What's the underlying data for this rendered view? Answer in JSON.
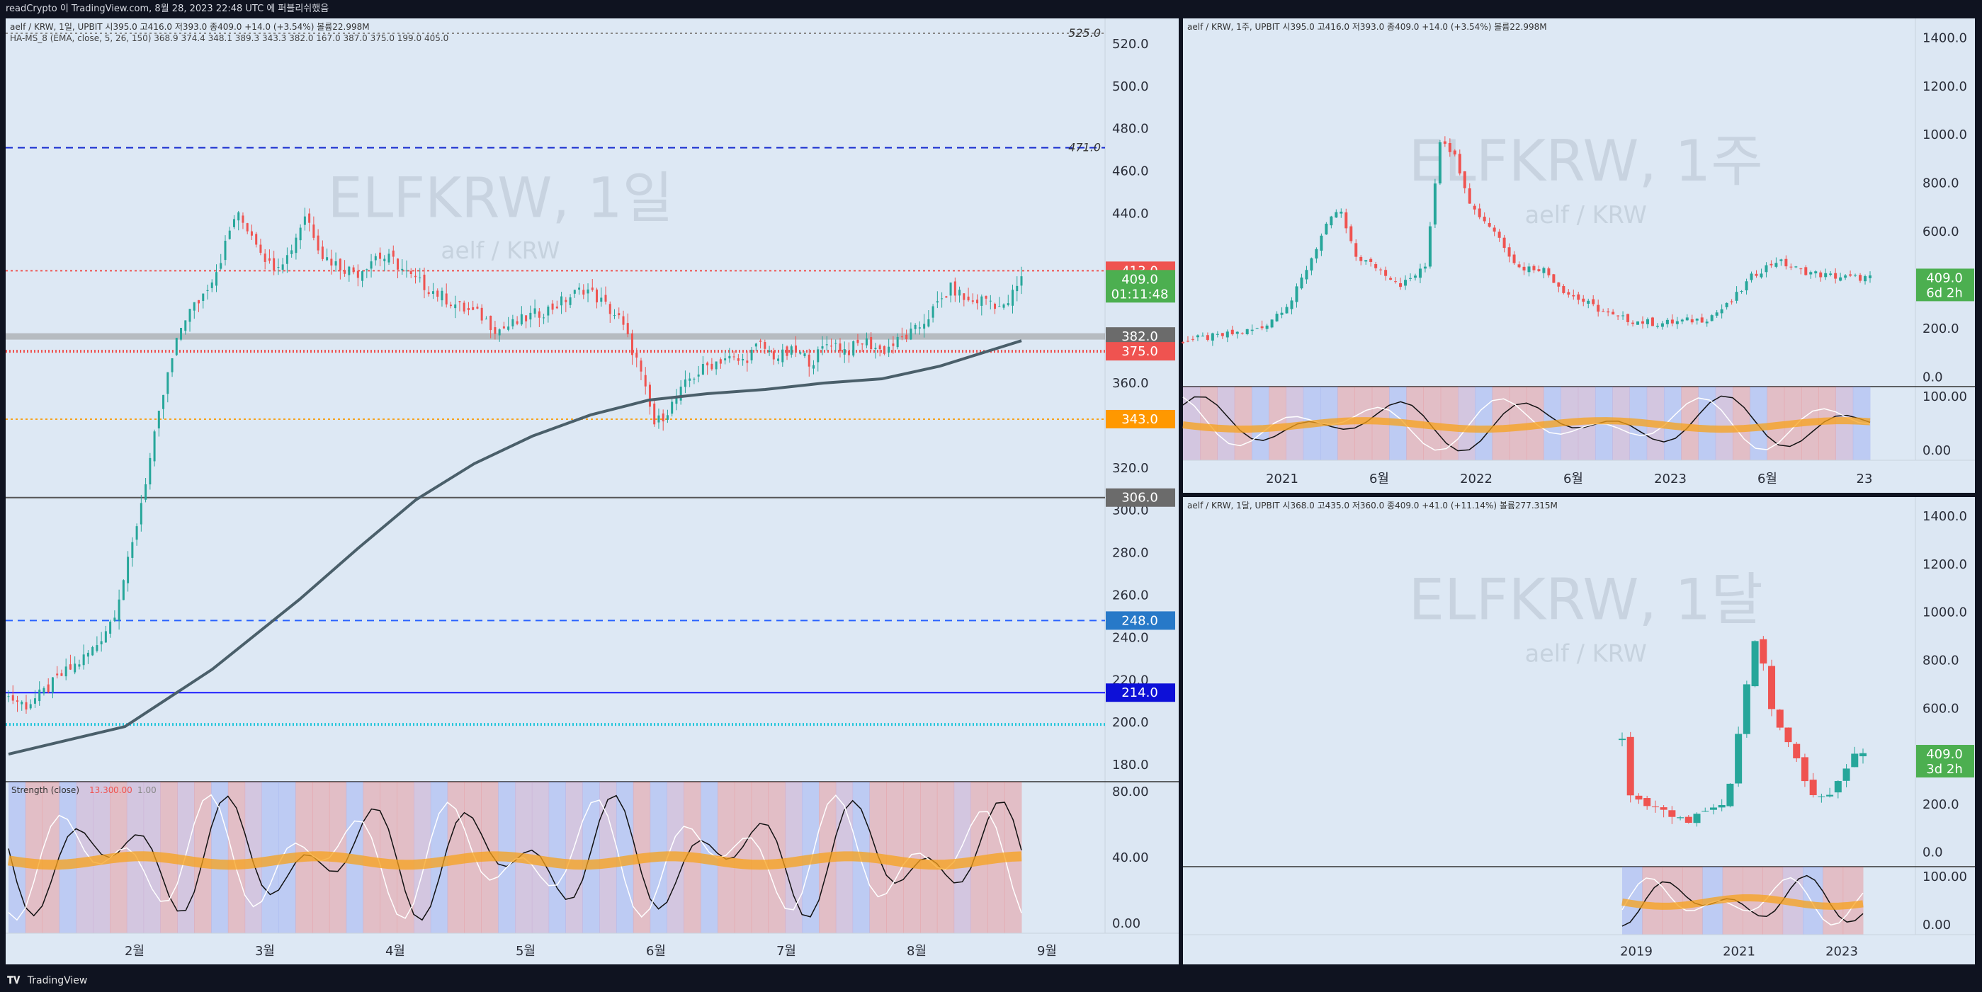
{
  "header": {
    "publish_text": "readCrypto 이 TradingView.com, 8월 28, 2023 22:48 UTC 에 퍼블리쉬했음"
  },
  "footer": {
    "brand": "TradingView",
    "logo": "tv-logo-icon"
  },
  "colors": {
    "bg": "#dfe9f5",
    "up": "#26a69a",
    "down": "#ef5350",
    "sma": "#4a5f6a",
    "green_tag": "#4caf50"
  },
  "chart_data": [
    {
      "type": "candlestick",
      "panel": "daily",
      "legend_line": "aelf / KRW, 1일, UPBIT  시395.0  고416.0  저393.0  종409.0  +14.0 (+3.54%)  볼륨22.998M",
      "indicator_line": "HA-MS_8 (EMA, close, 5, 26, 150)  368.9  374.4  348.1  389.3  343.3  382.0  167.0  387.0  375.0  199.0  405.0",
      "watermark": "ELFKRW, 1일",
      "watermark_sub": "aelf / KRW",
      "yticks": [
        "520.0",
        "500.0",
        "480.0",
        "460.0",
        "440.0",
        "420.0",
        "400.0",
        "380.0",
        "360.0",
        "340.0",
        "320.0",
        "300.0",
        "280.0",
        "260.0",
        "240.0",
        "220.0",
        "200.0",
        "180.0"
      ],
      "yticks_display": [
        "520.0",
        "500.0",
        "480.0",
        "460.0",
        "440.0",
        "",
        "",
        "",
        "360.0",
        "",
        "320.0",
        "300.0",
        "280.0",
        "260.0",
        "240.0",
        "220.0",
        "200.0",
        "180.0"
      ],
      "ylim": [
        172,
        532
      ],
      "xticks": [
        "2월",
        "3월",
        "4월",
        "5월",
        "6월",
        "7월",
        "8월",
        "9월"
      ],
      "close_path": [
        [
          0,
          212
        ],
        [
          3,
          208
        ],
        [
          6,
          214
        ],
        [
          9,
          222
        ],
        [
          12,
          228
        ],
        [
          15,
          236
        ],
        [
          18,
          250
        ],
        [
          21,
          280
        ],
        [
          24,
          320
        ],
        [
          27,
          360
        ],
        [
          30,
          390
        ],
        [
          33,
          400
        ],
        [
          36,
          415
        ],
        [
          39,
          440
        ],
        [
          42,
          430
        ],
        [
          45,
          415
        ],
        [
          48,
          420
        ],
        [
          51,
          440
        ],
        [
          54,
          420
        ],
        [
          57,
          415
        ],
        [
          60,
          412
        ],
        [
          63,
          420
        ],
        [
          66,
          418
        ],
        [
          69,
          410
        ],
        [
          72,
          405
        ],
        [
          75,
          400
        ],
        [
          78,
          395
        ],
        [
          81,
          392
        ],
        [
          84,
          385
        ],
        [
          87,
          388
        ],
        [
          90,
          392
        ],
        [
          93,
          395
        ],
        [
          96,
          400
        ],
        [
          99,
          405
        ],
        [
          102,
          398
        ],
        [
          105,
          390
        ],
        [
          108,
          370
        ],
        [
          111,
          340
        ],
        [
          114,
          350
        ],
        [
          117,
          362
        ],
        [
          120,
          368
        ],
        [
          123,
          372
        ],
        [
          126,
          370
        ],
        [
          129,
          378
        ],
        [
          132,
          372
        ],
        [
          135,
          375
        ],
        [
          138,
          370
        ],
        [
          141,
          380
        ],
        [
          144,
          375
        ],
        [
          147,
          380
        ],
        [
          150,
          375
        ],
        [
          153,
          380
        ],
        [
          156,
          385
        ],
        [
          159,
          395
        ],
        [
          162,
          405
        ],
        [
          165,
          398
        ],
        [
          168,
          400
        ],
        [
          171,
          395
        ],
        [
          174,
          409
        ]
      ],
      "high_path": [
        [
          0,
          218
        ],
        [
          12,
          235
        ],
        [
          24,
          330
        ],
        [
          36,
          420
        ],
        [
          39,
          470
        ],
        [
          42,
          455
        ],
        [
          48,
          430
        ],
        [
          51,
          475
        ],
        [
          54,
          450
        ],
        [
          60,
          430
        ],
        [
          72,
          420
        ],
        [
          84,
          400
        ],
        [
          96,
          410
        ],
        [
          102,
          420
        ],
        [
          108,
          390
        ],
        [
          114,
          370
        ],
        [
          120,
          385
        ],
        [
          132,
          385
        ],
        [
          144,
          390
        ],
        [
          156,
          395
        ],
        [
          162,
          435
        ],
        [
          168,
          425
        ],
        [
          174,
          416
        ]
      ],
      "low_path": [
        [
          0,
          205
        ],
        [
          12,
          222
        ],
        [
          24,
          300
        ],
        [
          36,
          380
        ],
        [
          39,
          400
        ],
        [
          48,
          390
        ],
        [
          60,
          392
        ],
        [
          72,
          385
        ],
        [
          84,
          372
        ],
        [
          96,
          375
        ],
        [
          102,
          372
        ],
        [
          108,
          330
        ],
        [
          111,
          328
        ],
        [
          114,
          335
        ],
        [
          120,
          355
        ],
        [
          132,
          358
        ],
        [
          144,
          360
        ],
        [
          156,
          370
        ],
        [
          162,
          380
        ],
        [
          168,
          380
        ],
        [
          174,
          393
        ]
      ],
      "sma150": [
        [
          0,
          185
        ],
        [
          20,
          198
        ],
        [
          35,
          225
        ],
        [
          50,
          258
        ],
        [
          60,
          282
        ],
        [
          70,
          305
        ],
        [
          80,
          322
        ],
        [
          90,
          335
        ],
        [
          100,
          345
        ],
        [
          110,
          352
        ],
        [
          120,
          355
        ],
        [
          130,
          357
        ],
        [
          140,
          360
        ],
        [
          150,
          362
        ],
        [
          160,
          368
        ],
        [
          174,
          380
        ]
      ],
      "level_lines": [
        {
          "value": 471.0,
          "label": "471.0",
          "color": "#1a2fd0",
          "style": "dashed"
        },
        {
          "value": 525.0,
          "label": "525.0",
          "color": "#888",
          "style": "dotted"
        },
        {
          "value": 413.0,
          "label": "",
          "color": "#ef5350",
          "style": "dotted"
        },
        {
          "value": 382.0,
          "label": "",
          "color": "#9e9e9e",
          "style": "thick"
        },
        {
          "value": 375.0,
          "label": "",
          "color": "#ef5350",
          "style": "cross"
        },
        {
          "value": 343.0,
          "label": "",
          "color": "#f7a21b",
          "style": "dotted"
        },
        {
          "value": 306.0,
          "label": "",
          "color": "#555",
          "style": "solid"
        },
        {
          "value": 248.0,
          "label": "",
          "color": "#2962ff",
          "style": "dashed"
        },
        {
          "value": 214.0,
          "label": "",
          "color": "#1a1aff",
          "style": "solid"
        },
        {
          "value": 199.0,
          "label": "",
          "color": "#26c6da",
          "style": "cross"
        }
      ],
      "price_tags": [
        {
          "value": 413.0,
          "text": "413.0",
          "color": "#ef5350"
        },
        {
          "value": 409.0,
          "text": "409.0",
          "sub": "01:11:48",
          "color": "#4caf50"
        },
        {
          "value": 382.0,
          "text": "382.0",
          "color": "#6b6b6b"
        },
        {
          "value": 375.0,
          "text": "375.0",
          "color": "#ef5350"
        },
        {
          "value": 343.0,
          "text": "343.0",
          "color": "#ff9800"
        },
        {
          "value": 306.0,
          "text": "306.0",
          "color": "#6b6b6b"
        },
        {
          "value": 248.0,
          "text": "248.0",
          "color": "#2779c8"
        },
        {
          "value": 214.0,
          "text": "214.0",
          "color": "#0d10d8"
        }
      ],
      "strength_label": "Strength (close)",
      "strength_values": [
        "13.30",
        "0.00",
        "1.00"
      ],
      "strength_yticks": [
        "80.00",
        "40.00",
        "0.00"
      ]
    },
    {
      "type": "candlestick",
      "panel": "weekly",
      "legend_line": "aelf / KRW, 1주, UPBIT  시395.0  고416.0  저393.0  종409.0  +14.0 (+3.54%)  볼륨22.998M",
      "watermark": "ELFKRW, 1주",
      "watermark_sub": "aelf / KRW",
      "yticks": [
        "1400.0",
        "1200.0",
        "1000.0",
        "800.0",
        "600.0",
        "400.0",
        "200.0",
        "0.0"
      ],
      "ylim": [
        -40,
        1480
      ],
      "xticks": [
        "2021",
        "6월",
        "2022",
        "6월",
        "2023",
        "6월",
        "23"
      ],
      "close_path": [
        [
          0,
          150
        ],
        [
          5,
          170
        ],
        [
          10,
          200
        ],
        [
          14,
          320
        ],
        [
          18,
          600
        ],
        [
          20,
          700
        ],
        [
          22,
          500
        ],
        [
          25,
          450
        ],
        [
          28,
          380
        ],
        [
          31,
          450
        ],
        [
          33,
          1000
        ],
        [
          35,
          900
        ],
        [
          37,
          700
        ],
        [
          40,
          600
        ],
        [
          43,
          450
        ],
        [
          46,
          450
        ],
        [
          49,
          350
        ],
        [
          52,
          300
        ],
        [
          55,
          250
        ],
        [
          58,
          230
        ],
        [
          61,
          220
        ],
        [
          64,
          230
        ],
        [
          67,
          240
        ],
        [
          70,
          300
        ],
        [
          73,
          420
        ],
        [
          76,
          480
        ],
        [
          79,
          440
        ],
        [
          82,
          420
        ],
        [
          85,
          410
        ],
        [
          88,
          409
        ]
      ],
      "price_tags": [
        {
          "value": 409.0,
          "text": "409.0",
          "sub": "6d 2h",
          "color": "#4caf50"
        }
      ],
      "strength_yticks": [
        "100.00",
        "0.00"
      ]
    },
    {
      "type": "candlestick",
      "panel": "monthly",
      "legend_line": "aelf / KRW, 1달, UPBIT  시368.0  고435.0  저360.0  종409.0  +41.0 (+11.14%)  볼륨277.315M",
      "watermark": "ELFKRW, 1달",
      "watermark_sub": "aelf / KRW",
      "yticks": [
        "1400.0",
        "1200.0",
        "1000.0",
        "800.0",
        "600.0",
        "400.0",
        "200.0",
        "0.0"
      ],
      "ylim": [
        -60,
        1480
      ],
      "xticks": [
        "2019",
        "2021",
        "2023"
      ],
      "close_path": [
        [
          0,
          460
        ],
        [
          1,
          250
        ],
        [
          2,
          200
        ],
        [
          3,
          180
        ],
        [
          4,
          190
        ],
        [
          5,
          160
        ],
        [
          6,
          150
        ],
        [
          7,
          140
        ],
        [
          8,
          130
        ],
        [
          9,
          150
        ],
        [
          10,
          170
        ],
        [
          11,
          180
        ],
        [
          12,
          200
        ],
        [
          13,
          300
        ],
        [
          14,
          500
        ],
        [
          15,
          700
        ],
        [
          16,
          900
        ],
        [
          17,
          800
        ],
        [
          18,
          600
        ],
        [
          19,
          500
        ],
        [
          20,
          450
        ],
        [
          21,
          400
        ],
        [
          22,
          300
        ],
        [
          23,
          250
        ],
        [
          24,
          230
        ],
        [
          25,
          220
        ],
        [
          26,
          280
        ],
        [
          27,
          350
        ],
        [
          28,
          400
        ],
        [
          29,
          409
        ]
      ],
      "price_tags": [
        {
          "value": 409.0,
          "text": "409.0",
          "sub": "3d 2h",
          "color": "#4caf50"
        }
      ],
      "strength_yticks": [
        "100.00",
        "0.00"
      ]
    }
  ]
}
